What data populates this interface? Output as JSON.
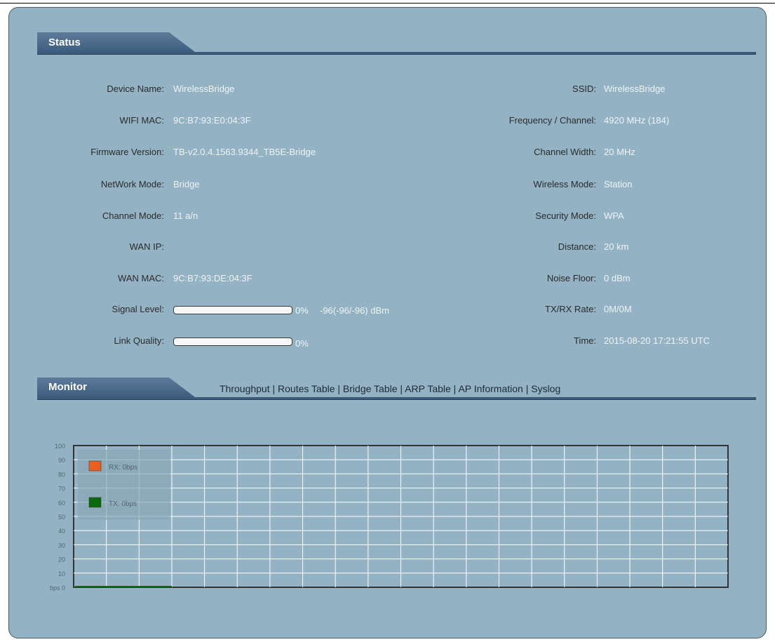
{
  "status": {
    "title": "Status",
    "left_fields": [
      {
        "label": "Device Name:",
        "value": "WirelessBridge"
      },
      {
        "label": "WIFI MAC:",
        "value": "9C:B7:93:E0:04:3F"
      },
      {
        "label": "Firmware Version:",
        "value": "TB-v2.0.4.1563.9344_TB5E-Bridge"
      },
      {
        "label": "NetWork Mode:",
        "value": "Bridge"
      },
      {
        "label": "Channel Mode:",
        "value": "11 a/n"
      },
      {
        "label": "WAN IP:",
        "value": ""
      },
      {
        "label": "WAN MAC:",
        "value": "9C:B7:93:DE:04:3F"
      }
    ],
    "signal": {
      "label": "Signal Level:",
      "percent": 0,
      "percent_text": "0%",
      "dbm_text": "-96(-96/-96) dBm"
    },
    "link": {
      "label": "Link Quality:",
      "percent": 0,
      "percent_text": "0%"
    },
    "right_fields": [
      {
        "label": "SSID:",
        "value": "WirelessBridge"
      },
      {
        "label": "Frequency / Channel:",
        "value": "4920 MHz (184)"
      },
      {
        "label": "Channel Width:",
        "value": "20 MHz"
      },
      {
        "label": "Wireless Mode:",
        "value": "Station"
      },
      {
        "label": "Security Mode:",
        "value": "WPA"
      },
      {
        "label": "Distance:",
        "value": "20 km"
      },
      {
        "label": "Noise Floor:",
        "value": "0 dBm"
      },
      {
        "label": "TX/RX Rate:",
        "value": "0M/0M"
      },
      {
        "label": "Time:",
        "value": "2015-08-20 17:21:55 UTC"
      }
    ]
  },
  "monitor": {
    "title": "Monitor",
    "links": [
      "Throughput",
      "Routes Table",
      "Bridge Table",
      "ARP Table",
      "AP Information",
      "Syslog"
    ]
  },
  "chart_data": {
    "type": "line",
    "y_ticks": [
      "100",
      "90",
      "80",
      "70",
      "60",
      "50",
      "40",
      "30",
      "20",
      "10",
      "bps 0"
    ],
    "ylim": [
      0,
      100
    ],
    "grid": true,
    "legend_position": "top-left",
    "series": [
      {
        "name": "RX: 0bps",
        "color": "#e8601c",
        "values": [
          0,
          0,
          0,
          0
        ]
      },
      {
        "name": "TX: 0bps",
        "color": "#0b6a0b",
        "values": [
          0,
          0,
          0,
          0
        ]
      }
    ]
  },
  "colors": {
    "panel_bg": "#93b2c4",
    "header_bar": "#3d5a78",
    "chart_bg": "#93b2c4",
    "grid": "#ffffff"
  }
}
